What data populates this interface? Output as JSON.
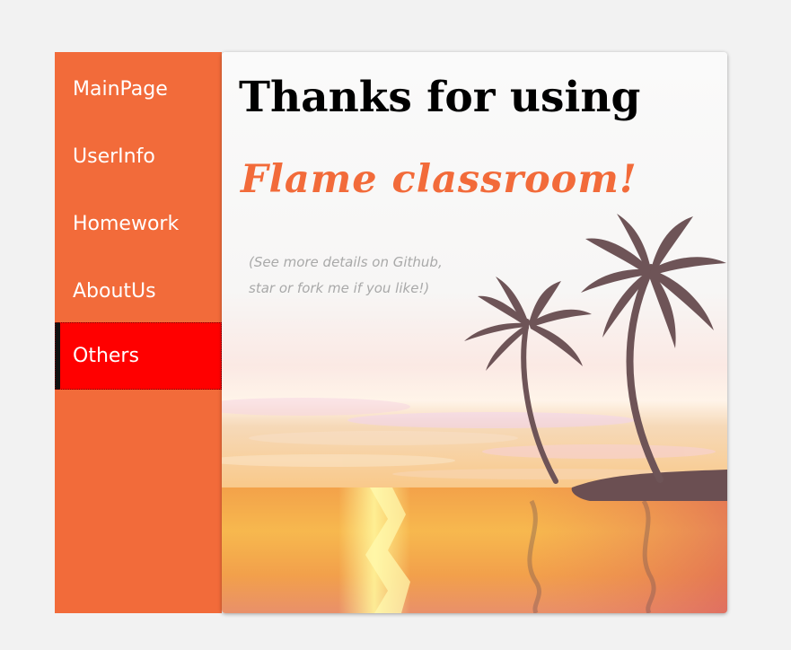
{
  "sidebar": {
    "items": [
      {
        "label": "MainPage"
      },
      {
        "label": "UserInfo"
      },
      {
        "label": "Homework"
      },
      {
        "label": "AboutUs"
      },
      {
        "label": "Others",
        "active": true
      }
    ]
  },
  "content": {
    "title": "Thanks for using",
    "subtitle": "Flame classroom!",
    "note_line1": "(See more details on Github,",
    "note_line2": "star or fork me if you like!)"
  },
  "colors": {
    "sidebar_bg": "#f26b3a",
    "active_item_bg": "#ff0000",
    "accent": "#f26b3a",
    "page_bg": "#f2f2f2"
  },
  "illustration": {
    "name": "sunset-beach-palm-trees"
  }
}
